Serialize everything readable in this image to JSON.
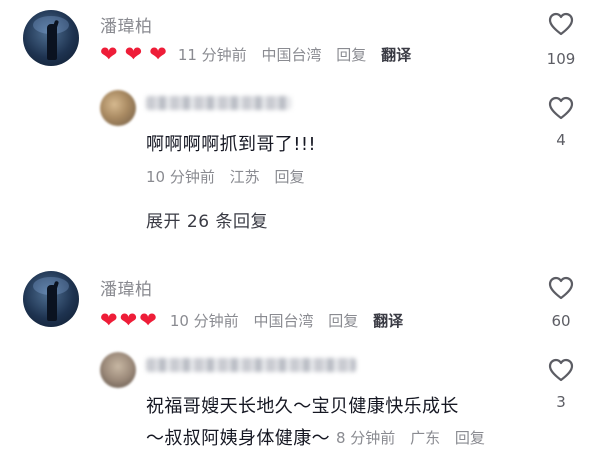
{
  "comments": [
    {
      "author": "潘瑋柏",
      "emojis": [
        "❤",
        "❤",
        "❤"
      ],
      "time": "11 分钟前",
      "location": "中国台湾",
      "reply": "回复",
      "translate": "翻译",
      "likes": "109",
      "sub_reply": {
        "content": "啊啊啊啊抓到哥了!!!",
        "time": "10 分钟前",
        "location": "江苏",
        "reply": "回复",
        "likes": "4"
      },
      "expand": "展开 26 条回复"
    },
    {
      "author": "潘瑋柏",
      "emojis": [
        "❤",
        "❤",
        "❤"
      ],
      "time": "10 分钟前",
      "location": "中国台湾",
      "reply": "回复",
      "translate": "翻译",
      "likes": "60",
      "sub_reply": {
        "content_line1": "祝福哥嫂天长地久～宝贝健康快乐成长",
        "content_line2": "～叔叔阿姨身体健康～",
        "time": "8 分钟前",
        "location": "广东",
        "reply": "回复",
        "likes": "3"
      }
    }
  ],
  "colors": {
    "heart": "#ee1d38",
    "meta": "#8a8b91",
    "text": "#161823"
  }
}
